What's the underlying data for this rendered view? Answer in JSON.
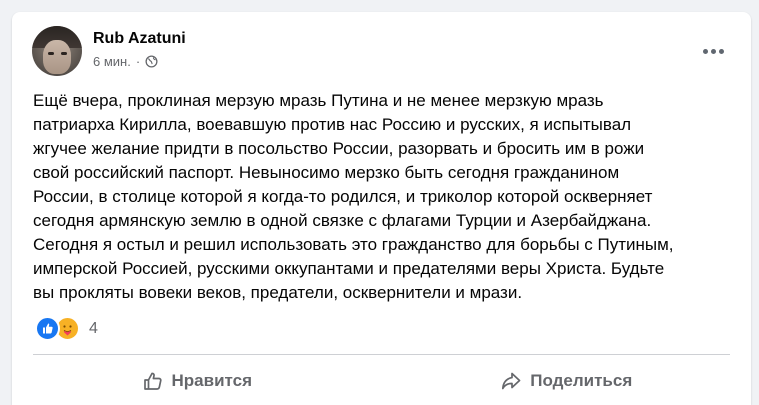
{
  "post": {
    "author": "Rub Azatuni",
    "time": "6 мин.",
    "separator": "·",
    "privacy_icon": "globe-icon",
    "more_icon": "more-options-icon",
    "text_lines": [
      "Ещё вчера, проклиная мерзую мразь Путина и не менее мерзкую мразь",
      "патриарха Кирилла, воевавшую против нас Россию и русских, я испытывал",
      "жгучее желание придти в посольство России, разорвать и бросить им в рожи",
      "свой российский паспорт. Невыносимо мерзко быть сегодня гражданином",
      "России, в столице которой я когда-то родился, и триколор которой оскверняет",
      "сегодня армянскую землю в одной связке с флагами Турции и Азербайджана.",
      "Сегодня я остыл и решил использовать это гражданство для борьбы с Путиным,",
      "имперской Россией, русскими оккупантами и предателями веры Христа. Будьте",
      "вы прокляты вовеки веков, предатели, осквернители и мрази."
    ]
  },
  "reactions": {
    "icons": [
      "like-reaction-icon",
      "care-reaction-icon"
    ],
    "count": "4"
  },
  "actions": {
    "like_label": "Нравится",
    "like_icon": "thumbs-up-icon",
    "share_label": "Поделиться",
    "share_icon": "share-arrow-icon"
  },
  "colors": {
    "background": "#f0f2f5",
    "card": "#ffffff",
    "text": "#050505",
    "secondary_text": "#65676b",
    "like_blue": "#1877f2",
    "care_yellow": "#f7b125"
  }
}
